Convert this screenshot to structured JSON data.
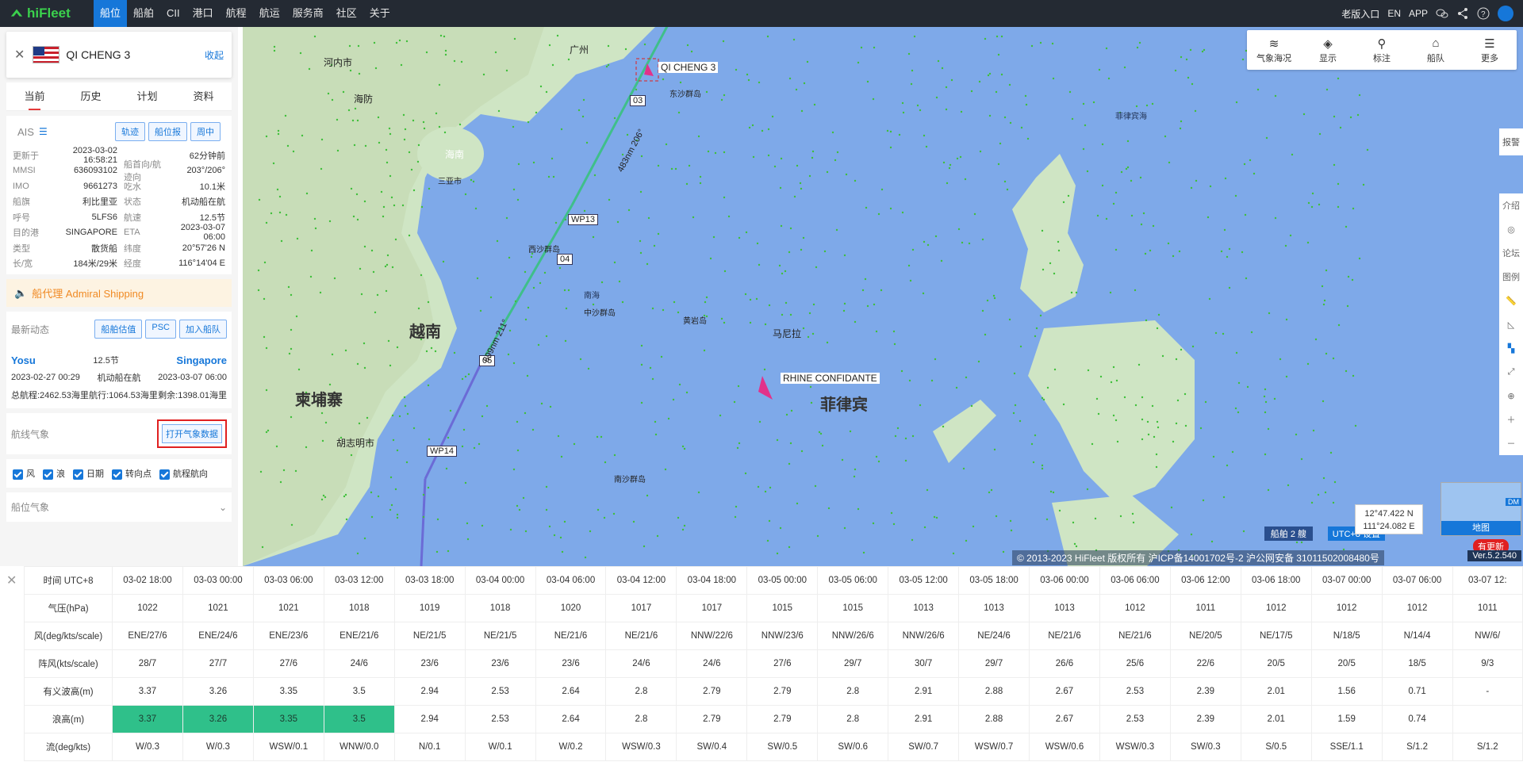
{
  "topbar": {
    "logo": "hiFleet",
    "nav": [
      "船位",
      "船舶",
      "CII",
      "港口",
      "航程",
      "航运",
      "服务商",
      "社区",
      "关于"
    ],
    "right": [
      "老版入口",
      "EN",
      "APP"
    ]
  },
  "ship": {
    "name": "QI CHENG 3",
    "collapse": "收起"
  },
  "tabs": [
    "当前",
    "历史",
    "计划",
    "资料"
  ],
  "ais": {
    "label": "AIS",
    "buttons": [
      "轨迹",
      "船位报",
      "周中"
    ]
  },
  "info": [
    {
      "k": "更新于",
      "v": "2023-03-02 16:58:21",
      "k2": "",
      "v2": "62分钟前"
    },
    {
      "k": "MMSI",
      "v": "636093102",
      "k2": "船首向/航迹向",
      "v2": "203°/206°"
    },
    {
      "k": "IMO",
      "v": "9661273",
      "k2": "吃水",
      "v2": "10.1米"
    },
    {
      "k": "船旗",
      "v": "利比里亚",
      "k2": "状态",
      "v2": "机动船在航"
    },
    {
      "k": "呼号",
      "v": "5LFS6",
      "k2": "航速",
      "v2": "12.5节"
    },
    {
      "k": "目的港",
      "v": "SINGAPORE",
      "k2": "ETA",
      "v2": "2023-03-07 06:00"
    },
    {
      "k": "类型",
      "v": "散货船",
      "k2": "纬度",
      "v2": "20°57'26 N"
    },
    {
      "k": "长/宽",
      "v": "184米/29米",
      "k2": "经度",
      "v2": "116°14'04 E"
    }
  ],
  "agent": "船代理 Admiral Shipping",
  "dynamic": {
    "label": "最新动态",
    "buttons": [
      "船舶估值",
      "PSC",
      "加入船队"
    ]
  },
  "voyage": {
    "from": "Yosu",
    "to": "Singapore",
    "speed": "12.5节",
    "status": "机动船在航",
    "from_time": "2023-02-27 00:29",
    "to_time": "2023-03-07 06:00",
    "total": "总航程:2462.53海里",
    "sailed": "航行:1064.53海里",
    "remain": "剩余:1398.01海里"
  },
  "weather": {
    "label": "航线气象",
    "button": "打开气象数据",
    "checks": [
      "风",
      "浪",
      "日期",
      "转向点",
      "航程航向"
    ],
    "next": "船位气象"
  },
  "map": {
    "toolbar": [
      "气象海况",
      "显示",
      "标注",
      "船队",
      "更多"
    ],
    "report": "报警",
    "right_tools": [
      "介绍",
      "论坛",
      "图例"
    ],
    "coords": [
      "12°47.422 N",
      "111°24.082 E"
    ],
    "minimap": "地图",
    "dm": "DM",
    "ships": "船舶 2 艘",
    "tz": "UTC+8 设置",
    "version": "Ver.5.2.540",
    "update": "有更新",
    "copyright": "© 2013-2023 HiFleet 版权所有 沪ICP备14001702号-2 沪公网安备 31011502008480号",
    "labels": [
      "QI CHENG 3",
      "RHINE CONFIDANTE",
      "越南",
      "柬埔寨",
      "菲律宾",
      "马尼拉",
      "海南",
      "南海",
      "西沙群岛",
      "中沙群岛",
      "黄岩岛",
      "南沙群岛",
      "东沙群岛",
      "胡志明市",
      "河内市",
      "海防",
      "三亚市",
      "广州",
      "菲律宾海"
    ],
    "waypoints": [
      "WP13",
      "WP14",
      "03",
      "04",
      "05"
    ],
    "legs": [
      "483nm 206°",
      "699nm 211°"
    ]
  },
  "table": {
    "header": "时间 UTC+8",
    "times": [
      "03-02 18:00",
      "03-03 00:00",
      "03-03 06:00",
      "03-03 12:00",
      "03-03 18:00",
      "03-04 00:00",
      "03-04 06:00",
      "03-04 12:00",
      "03-04 18:00",
      "03-05 00:00",
      "03-05 06:00",
      "03-05 12:00",
      "03-05 18:00",
      "03-06 00:00",
      "03-06 06:00",
      "03-06 12:00",
      "03-06 18:00",
      "03-07 00:00",
      "03-07 06:00",
      "03-07 12:"
    ],
    "rows": [
      {
        "label": "气压(hPa)",
        "values": [
          "1022",
          "1021",
          "1021",
          "1018",
          "1019",
          "1018",
          "1020",
          "1017",
          "1017",
          "1015",
          "1015",
          "1013",
          "1013",
          "1013",
          "1012",
          "1011",
          "1012",
          "1012",
          "1012",
          "1011"
        ]
      },
      {
        "label": "风(deg/kts/scale)",
        "values": [
          "ENE/27/6",
          "ENE/24/6",
          "ENE/23/6",
          "ENE/21/6",
          "NE/21/5",
          "NE/21/5",
          "NE/21/6",
          "NE/21/6",
          "NNW/22/6",
          "NNW/23/6",
          "NNW/26/6",
          "NNW/26/6",
          "NE/24/6",
          "NE/21/6",
          "NE/21/6",
          "NE/20/5",
          "NE/17/5",
          "N/18/5",
          "N/14/4",
          "NW/6/"
        ]
      },
      {
        "label": "阵风(kts/scale)",
        "values": [
          "28/7",
          "27/7",
          "27/6",
          "24/6",
          "23/6",
          "23/6",
          "23/6",
          "24/6",
          "24/6",
          "27/6",
          "29/7",
          "30/7",
          "29/7",
          "26/6",
          "25/6",
          "22/6",
          "20/5",
          "20/5",
          "18/5",
          "9/3"
        ]
      },
      {
        "label": "有义波高(m)",
        "values": [
          "3.37",
          "3.26",
          "3.35",
          "3.5",
          "2.94",
          "2.53",
          "2.64",
          "2.8",
          "2.79",
          "2.79",
          "2.8",
          "2.91",
          "2.88",
          "2.67",
          "2.53",
          "2.39",
          "2.01",
          "1.56",
          "0.71",
          "-"
        ]
      },
      {
        "label": "浪高(m)",
        "values": [
          "3.37",
          "3.26",
          "3.35",
          "3.5",
          "2.94",
          "2.53",
          "2.64",
          "2.8",
          "2.79",
          "2.79",
          "2.8",
          "2.91",
          "2.88",
          "2.67",
          "2.53",
          "2.39",
          "2.01",
          "1.59",
          "0.74",
          ""
        ],
        "highlight": [
          0,
          1,
          2,
          3
        ]
      },
      {
        "label": "流(deg/kts)",
        "values": [
          "W/0.3",
          "W/0.3",
          "WSW/0.1",
          "WNW/0.0",
          "N/0.1",
          "W/0.1",
          "W/0.2",
          "WSW/0.3",
          "SW/0.4",
          "SW/0.5",
          "SW/0.6",
          "SW/0.7",
          "WSW/0.7",
          "WSW/0.6",
          "WSW/0.3",
          "SW/0.3",
          "S/0.5",
          "SSE/1.1",
          "S/1.2",
          "S/1.2"
        ]
      }
    ]
  }
}
